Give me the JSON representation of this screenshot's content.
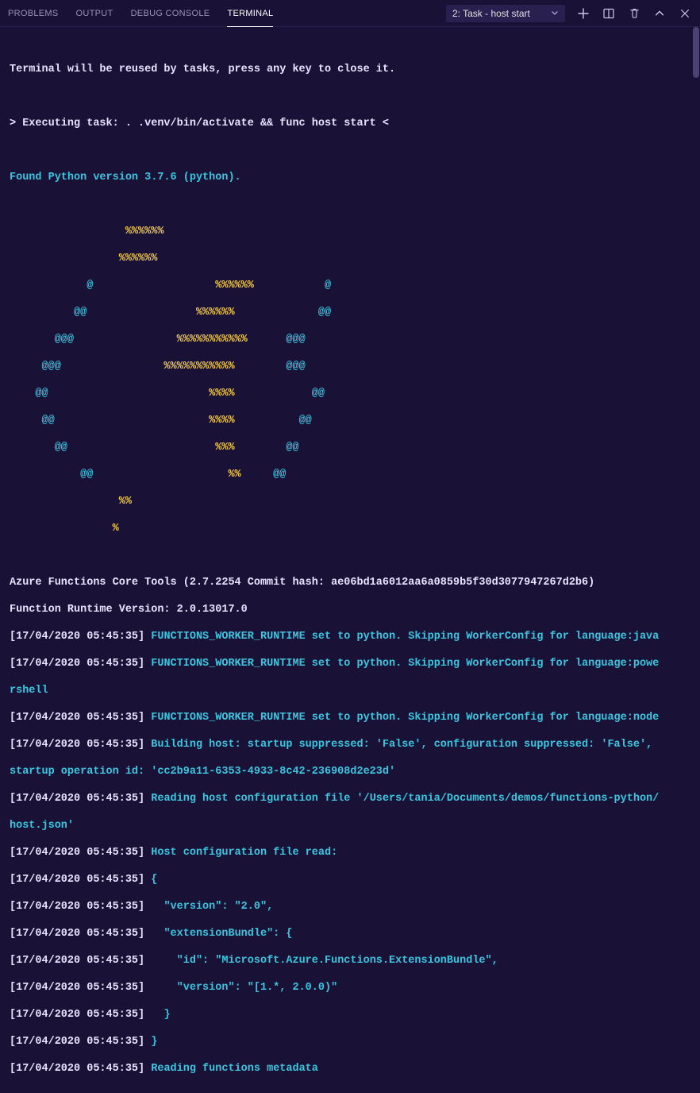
{
  "tabs": {
    "problems": "PROBLEMS",
    "output": "OUTPUT",
    "debug_console": "DEBUG CONSOLE",
    "terminal": "TERMINAL"
  },
  "dropdown": {
    "label": "2: Task - host start"
  },
  "term": {
    "reuse": "Terminal will be reused by tasks, press any key to close it.",
    "exec": "> Executing task: . .venv/bin/activate && func host start <",
    "found_python": "Found Python version 3.7.6 (python).",
    "logo": [
      {
        "y": "                  %%%%%%",
        "c": ""
      },
      {
        "y": "                 %%%%%%",
        "c": ""
      },
      {
        "y": "                %%%%%%",
        "c": "            @   ",
        "c2": "           @"
      },
      {
        "y": "              %%%%%%",
        "c": "          @@   ",
        "c2": "             @@"
      },
      {
        "y": "            %%%%%%%%%%%",
        "c": "       @@@    ",
        "c2": "      @@@"
      },
      {
        "y": "          %%%%%%%%%%%",
        "c": "     @@@      ",
        "c2": "        @@@"
      },
      {
        "y": "                %%%%",
        "c": "    @@         ",
        "c2": "            @@"
      },
      {
        "y": "                 %%%%",
        "c": "     @@       ",
        "c2": "          @@"
      },
      {
        "y": "                  %%%",
        "c": "       @@     ",
        "c2": "        @@"
      },
      {
        "y": "                  %%",
        "c": "           @@   ",
        "c2": "     @@"
      },
      {
        "y": "                 %%",
        "c": "",
        "c2": ""
      },
      {
        "y": "                %",
        "c": "",
        "c2": ""
      }
    ],
    "core_tools": "Azure Functions Core Tools (2.7.2254 Commit hash: ae06bd1a6012aa6a0859b5f30d3077947267d2b6)",
    "runtime_version": "Function Runtime Version: 2.0.13017.0",
    "log_prefix": "[17/04/2020 05:45:35]",
    "msg_java": "FUNCTIONS_WORKER_RUNTIME set to python. Skipping WorkerConfig for language:java",
    "msg_powe": "FUNCTIONS_WORKER_RUNTIME set to python. Skipping WorkerConfig for language:powe",
    "msg_rshell": "rshell",
    "msg_node": "FUNCTIONS_WORKER_RUNTIME set to python. Skipping WorkerConfig for language:node",
    "msg_build1": "Building host: startup suppressed: 'False', configuration suppressed: 'False',",
    "msg_build2": "startup operation id: 'cc2b9a11-6353-4933-8c42-236908d2e23d'",
    "msg_readhost1": "Reading host configuration file '/Users/tania/Documents/demos/functions-python/",
    "msg_readhost2": "host.json'",
    "msg_hostread": "Host configuration file read:",
    "json_open": "{",
    "json_version": "  \"version\": \"2.0\",",
    "json_ext": "  \"extensionBundle\": {",
    "json_id": "    \"id\": \"Microsoft.Azure.Functions.ExtensionBundle\",",
    "json_ver": "    \"version\": \"[1.*, 2.0.0)\"",
    "json_close_inner": "  }",
    "json_close": "}",
    "msg_readfunc": "Reading functions metadata"
  }
}
